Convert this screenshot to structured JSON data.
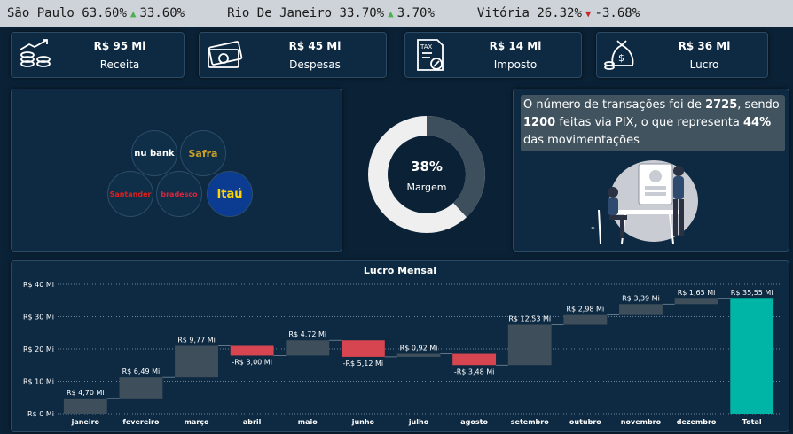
{
  "ticker": [
    {
      "city": "São Paulo",
      "share": "63.60%",
      "direction": "up",
      "change": "33.60%"
    },
    {
      "city": "Rio De Janeiro",
      "share": "33.70%",
      "direction": "up",
      "change": "3.70%"
    },
    {
      "city": "Vitória",
      "share": "26.32%",
      "direction": "down",
      "change": "-3.68%"
    }
  ],
  "kpis": {
    "receita": {
      "value": "R$ 95 Mi",
      "label": "Receita",
      "icon": "coins-growth-icon"
    },
    "despesas": {
      "value": "R$ 45 Mi",
      "label": "Despesas",
      "icon": "money-bills-icon"
    },
    "imposto": {
      "value": "R$ 14 Mi",
      "label": "Imposto",
      "icon": "tax-document-icon"
    },
    "lucro": {
      "value": "R$ 36 Mi",
      "label": "Lucro",
      "icon": "money-bag-icon"
    }
  },
  "banks": [
    {
      "name": "nubank",
      "display": "nu bank",
      "color": "#ffffff"
    },
    {
      "name": "Safra",
      "display": "Safra",
      "color": "#c9a227"
    },
    {
      "name": "Santander",
      "display": "Santander",
      "color": "#e01e1e"
    },
    {
      "name": "bradesco",
      "display": "bradesco",
      "color": "#d7263d"
    },
    {
      "name": "Itaú",
      "display": "Itaú",
      "color": "#0b3c91"
    }
  ],
  "margin": {
    "percent": "38%",
    "label": "Margem",
    "value": 0.38,
    "color_fill": "#3d4f5c",
    "color_rest": "#efefef"
  },
  "info": {
    "part1": "O número de transações foi de ",
    "transactions": "2725",
    "part2": ", sendo ",
    "pix": "1200",
    "part3": " feitas via PIX, o que representa ",
    "percent": "44%",
    "part4": " das movimentações"
  },
  "chart_data": {
    "type": "waterfall",
    "title": "Lucro Mensal",
    "categories": [
      "janeiro",
      "fevereiro",
      "março",
      "abril",
      "maio",
      "junho",
      "julho",
      "agosto",
      "setembro",
      "outubro",
      "novembro",
      "dezembro",
      "Total"
    ],
    "values": [
      4.7,
      6.49,
      9.77,
      -3.0,
      4.72,
      -5.12,
      0.92,
      -3.48,
      12.53,
      2.98,
      3.39,
      1.65,
      35.55
    ],
    "labels": [
      "R$ 4,70 Mi",
      "R$ 6,49 Mi",
      "R$ 9,77 Mi",
      "-R$ 3,00 Mi",
      "R$ 4,72 Mi",
      "-R$ 5,12 Mi",
      "R$ 0,92 Mi",
      "-R$ 3,48 Mi",
      "R$ 12,53 Mi",
      "R$ 2,98 Mi",
      "R$ 3,39 Mi",
      "R$ 1,65 Mi",
      "R$ 35,55 Mi"
    ],
    "yticks": [
      "R$ 0 Mi",
      "R$ 10 Mi",
      "R$ 20 Mi",
      "R$ 30 Mi",
      "R$ 40 Mi"
    ],
    "ylim": [
      0,
      40
    ],
    "colors": {
      "increase": "#3e4f5b",
      "decrease": "#d64550",
      "total": "#00b5a5"
    },
    "grid": true
  }
}
